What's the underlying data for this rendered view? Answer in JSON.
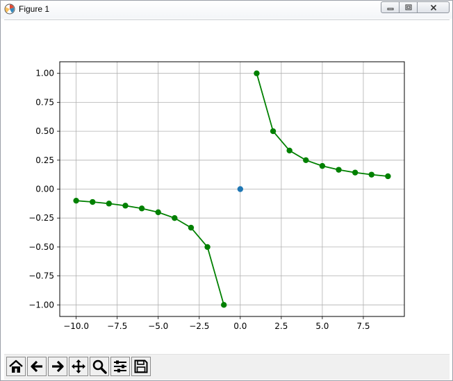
{
  "window": {
    "title": "Figure 1",
    "controls": [
      "minimize-icon",
      "maximize-icon",
      "close-icon"
    ]
  },
  "toolbar": {
    "buttons": [
      {
        "name": "home-icon",
        "tooltip": "Home"
      },
      {
        "name": "back-arrow-icon",
        "tooltip": "Back"
      },
      {
        "name": "forward-arrow-icon",
        "tooltip": "Forward"
      },
      {
        "name": "pan-move-icon",
        "tooltip": "Pan"
      },
      {
        "name": "zoom-magnifier-icon",
        "tooltip": "Zoom"
      },
      {
        "name": "configure-subplots-icon",
        "tooltip": "Subplots"
      },
      {
        "name": "save-disk-icon",
        "tooltip": "Save"
      }
    ]
  },
  "chart_data": {
    "type": "line",
    "title": "",
    "xlabel": "",
    "ylabel": "",
    "xlim": [
      -11,
      10
    ],
    "ylim": [
      -1.1,
      1.1
    ],
    "grid": true,
    "xticks": [
      -10.0,
      -7.5,
      -5.0,
      -2.5,
      0.0,
      2.5,
      5.0,
      7.5
    ],
    "xtick_labels": [
      "−10.0",
      "−7.5",
      "−5.0",
      "−2.5",
      "0.0",
      "2.5",
      "5.0",
      "7.5"
    ],
    "yticks": [
      1.0,
      0.75,
      0.5,
      0.25,
      0.0,
      -0.25,
      -0.5,
      -0.75,
      -1.0
    ],
    "ytick_labels": [
      "1.00",
      "0.75",
      "0.50",
      "0.25",
      "0.00",
      "−0.25",
      "−0.50",
      "−0.75",
      "−1.00"
    ],
    "series": [
      {
        "color": "#008000",
        "style": "line-with-markers",
        "x": [
          -10,
          -9,
          -8,
          -7,
          -6,
          -5,
          -4,
          -3,
          -2,
          -1
        ],
        "y": [
          -0.1,
          -0.111,
          -0.125,
          -0.143,
          -0.167,
          -0.2,
          -0.25,
          -0.333,
          -0.5,
          -1.0
        ]
      },
      {
        "color": "#008000",
        "style": "line-with-markers",
        "x": [
          1,
          2,
          3,
          4,
          5,
          6,
          7,
          8,
          9
        ],
        "y": [
          1.0,
          0.5,
          0.333,
          0.25,
          0.2,
          0.167,
          0.143,
          0.125,
          0.111
        ]
      },
      {
        "color": "#1f77b4",
        "style": "marker-only",
        "x": [
          0
        ],
        "y": [
          0
        ]
      }
    ]
  }
}
